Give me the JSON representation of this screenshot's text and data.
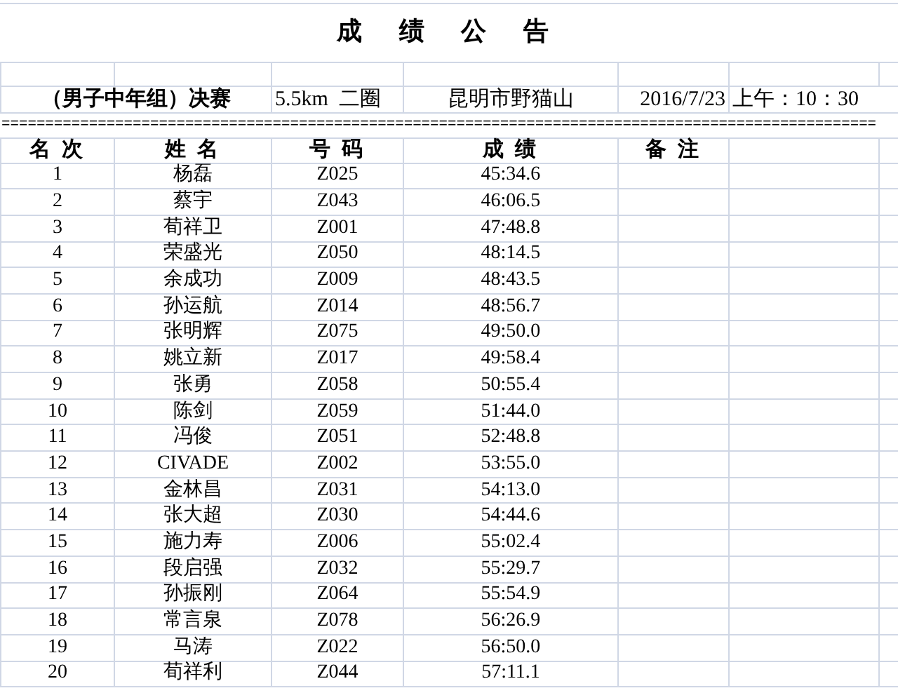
{
  "title": "成 绩 公 告",
  "info": [
    {
      "text": "（男子中年组）决赛",
      "bold": true
    },
    {
      "text": "5.5km  二圈",
      "bold": false
    },
    {
      "text": "昆明市野猫山",
      "bold": false
    },
    {
      "text": "2016/7/23",
      "bold": false
    },
    {
      "text": "上午：10：30",
      "bold": false
    }
  ],
  "separator": "====================================================================================================",
  "columns": [
    "名 次",
    "姓 名",
    "号 码",
    "成 绩",
    "备 注"
  ],
  "rows": [
    [
      "1",
      "杨磊",
      "Z025",
      "45:34.6"
    ],
    [
      "2",
      "蔡宇",
      "Z043",
      "46:06.5"
    ],
    [
      "3",
      "荀祥卫",
      "Z001",
      "47:48.8"
    ],
    [
      "4",
      "荣盛光",
      "Z050",
      "48:14.5"
    ],
    [
      "5",
      "余成功",
      "Z009",
      "48:43.5"
    ],
    [
      "6",
      "孙运航",
      "Z014",
      "48:56.7"
    ],
    [
      "7",
      "张明辉",
      "Z075",
      "49:50.0"
    ],
    [
      "8",
      "姚立新",
      "Z017",
      "49:58.4"
    ],
    [
      "9",
      "张勇",
      "Z058",
      "50:55.4"
    ],
    [
      "10",
      "陈剑",
      "Z059",
      "51:44.0"
    ],
    [
      "11",
      "冯俊",
      "Z051",
      "52:48.8"
    ],
    [
      "12",
      "CIVADE",
      "Z002",
      "53:55.0"
    ],
    [
      "13",
      "金林昌",
      "Z031",
      "54:13.0"
    ],
    [
      "14",
      "张大超",
      "Z030",
      "54:44.6"
    ],
    [
      "15",
      "施力寿",
      "Z006",
      "55:02.4"
    ],
    [
      "16",
      "段启强",
      "Z032",
      "55:29.7"
    ],
    [
      "17",
      "孙振刚",
      "Z064",
      "55:54.9"
    ],
    [
      "18",
      "常言泉",
      "Z078",
      "56:26.9"
    ],
    [
      "19",
      "马涛",
      "Z022",
      "56:50.0"
    ],
    [
      "20",
      "荀祥利",
      "Z044",
      "57:11.1"
    ]
  ]
}
